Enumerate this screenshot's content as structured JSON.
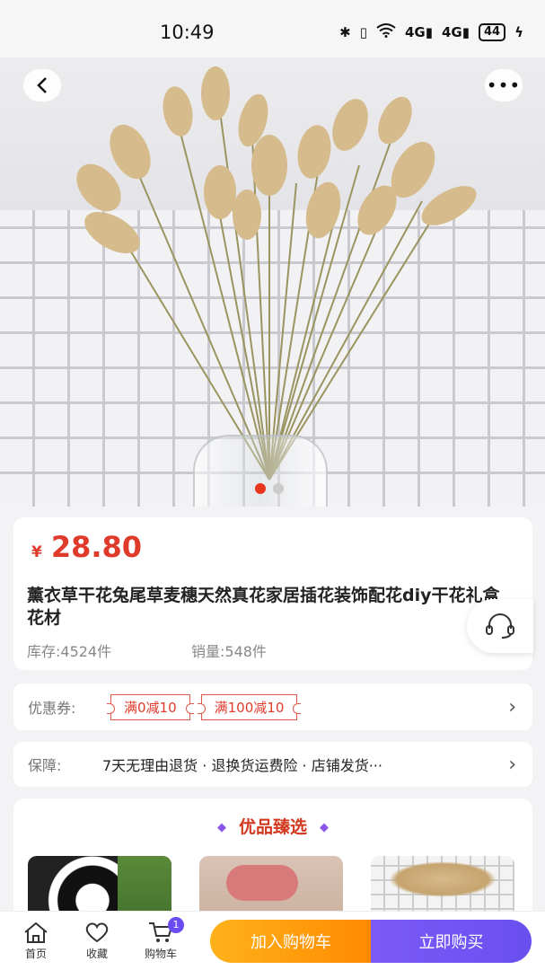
{
  "status_bar": {
    "time": "10:49",
    "network": "4G",
    "battery": "44"
  },
  "product": {
    "price_symbol": "¥",
    "price": "28.80",
    "title": "薰衣草干花兔尾草麦穗天然真花家居插花装饰配花diy干花礼盒花材",
    "stock": "库存:4524件",
    "sales": "销量:548件",
    "image_index": 1
  },
  "coupon": {
    "label": "优惠券:",
    "tags": [
      "满0减10",
      "满100减10"
    ]
  },
  "guarantee": {
    "label": "保障:",
    "text": "7天无理由退货 · 退换货运费险 · 店铺发货···"
  },
  "recommend": {
    "title": "优品臻选"
  },
  "bottom_bar": {
    "home_label": "首页",
    "fav_label": "收藏",
    "cart_label": "购物车",
    "cart_count": "1",
    "add_cart_label": "加入购物车",
    "buy_now_label": "立即购买"
  },
  "colors": {
    "price": "#e03a2a",
    "add_cart": "#ff9a0a",
    "buy_now": "#6e52f2",
    "accent_purple": "#8a55e8"
  }
}
